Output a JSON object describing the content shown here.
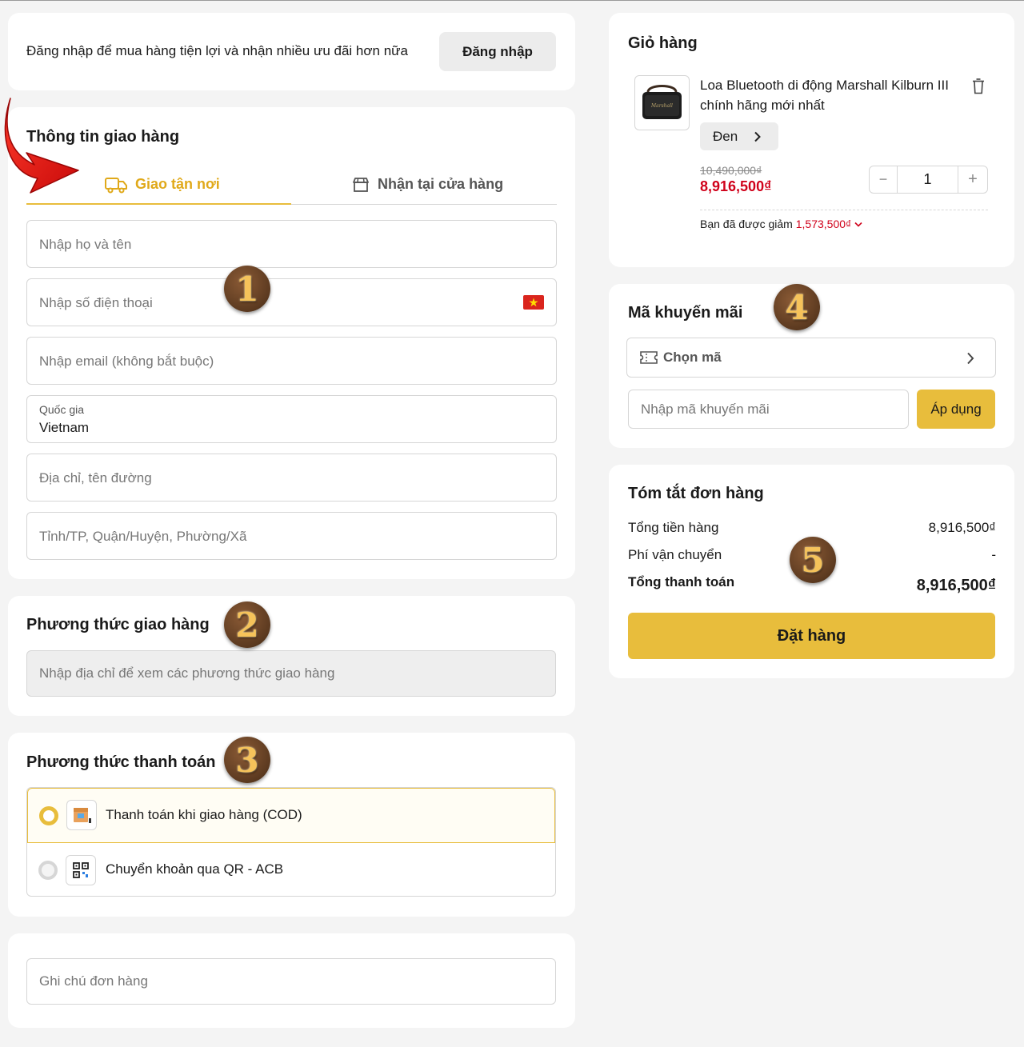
{
  "login_bar": {
    "prompt": "Đăng nhập để mua hàng tiện lợi và nhận nhiều ưu đãi hơn nữa",
    "button_label": "Đăng nhập"
  },
  "shipping_info": {
    "title": "Thông tin giao hàng",
    "tabs": [
      {
        "label": "Giao tận nơi",
        "icon": "truck-icon",
        "active": true
      },
      {
        "label": "Nhận tại cửa hàng",
        "icon": "store-icon",
        "active": false
      }
    ],
    "fields": {
      "full_name_placeholder": "Nhập họ và tên",
      "phone_placeholder": "Nhập số điện thoại",
      "email_placeholder": "Nhập email (không bắt buộc)",
      "country_label": "Quốc gia",
      "country_value": "Vietnam",
      "address_placeholder": "Địa chỉ, tên đường",
      "region_placeholder": "Tỉnh/TP, Quận/Huyện, Phường/Xã"
    }
  },
  "shipping_method": {
    "title": "Phương thức giao hàng",
    "notice": "Nhập địa chỉ để xem các phương thức giao hàng"
  },
  "payment_method": {
    "title": "Phương thức thanh toán",
    "options": [
      {
        "label": "Thanh toán khi giao hàng (COD)",
        "icon": "cod-box-icon",
        "selected": true
      },
      {
        "label": "Chuyển khoản qua QR - ACB",
        "icon": "qr-code-icon",
        "selected": false
      }
    ]
  },
  "order_note": {
    "placeholder": "Ghi chú đơn hàng"
  },
  "cart": {
    "title": "Giỏ hàng",
    "item": {
      "name_line1": "Loa Bluetooth di động Marshall Kilburn III",
      "name_line2": "chính hãng mới nhất",
      "variant": "Đen",
      "original_price": "10,490,000₫",
      "price": "8,916,500₫",
      "quantity": "1",
      "qty_minus": "−",
      "qty_plus": "+",
      "image_brand": "Marshall"
    },
    "discount_text": "Bạn đã được giảm",
    "discount_amount": "1,573,500₫"
  },
  "promo": {
    "title": "Mã khuyến mãi",
    "choose_label": "Chọn mã",
    "input_placeholder": "Nhập mã khuyến mãi",
    "apply_label": "Áp dụng"
  },
  "summary": {
    "title": "Tóm tắt đơn hàng",
    "subtotal_label": "Tổng tiền hàng",
    "subtotal_value": "8,916,500₫",
    "shipping_label": "Phí vận chuyển",
    "shipping_value": "-",
    "total_label": "Tổng thanh toán",
    "total_value": "8,916,500₫",
    "order_button": "Đặt hàng"
  },
  "annotations": [
    "1",
    "2",
    "3",
    "4",
    "5"
  ],
  "colors": {
    "accent": "#e8bd3c",
    "accent_text": "#e0a91a",
    "price_red": "#d0021b",
    "page_bg": "#f4f4f4",
    "arrow_red": "#e01414"
  }
}
